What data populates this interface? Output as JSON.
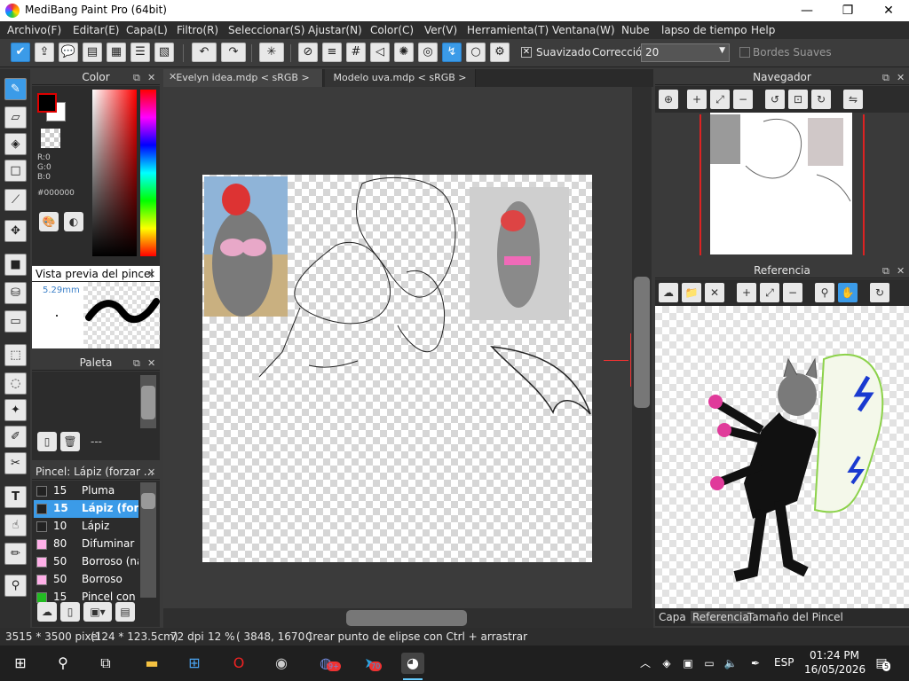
{
  "window": {
    "title": "MediBang Paint Pro (64bit)"
  },
  "menu": [
    "Archivo(F)",
    "Editar(E)",
    "Capa(L)",
    "Filtro(R)",
    "Seleccionar(S)",
    "Ajustar(N)",
    "Color(C)",
    "Ver(V)",
    "Herramienta(T)",
    "Ventana(W)",
    "Nube",
    "lapso de tiempo",
    "Help"
  ],
  "toolbar": {
    "smoothing_label": "Suavizado",
    "correction_label": "Corrección",
    "correction_value": "20",
    "soft_edges_label": "Bordes Suaves"
  },
  "color_panel": {
    "title": "Color",
    "r": "R:0",
    "g": "G:0",
    "b": "B:0",
    "hex": "#000000",
    "fg_color": "#000000",
    "bg_color": "#ffffff"
  },
  "brush_preview": {
    "title": "Vista previa del pincel",
    "size": "5.29mm"
  },
  "palette": {
    "title": "Paleta",
    "dash": "---"
  },
  "brush_panel": {
    "title": "Pincel: Lápiz (forzar ...",
    "items": [
      {
        "size": "15",
        "name": "Pluma",
        "color": "#222222"
      },
      {
        "size": "15",
        "name": "Lápiz (forza",
        "color": "#222222",
        "selected": true
      },
      {
        "size": "10",
        "name": "Lápiz",
        "color": "#222222"
      },
      {
        "size": "80",
        "name": "Difuminar",
        "color": "#ffb0e8"
      },
      {
        "size": "50",
        "name": "Borroso (nat",
        "color": "#ffb0e8"
      },
      {
        "size": "50",
        "name": "Borroso",
        "color": "#ffb0e8"
      },
      {
        "size": "15",
        "name": "Pincel con c",
        "color": "#22bb22"
      }
    ]
  },
  "tabs": [
    "Evelyn idea.mdp < sRGB >",
    "Modelo uva.mdp < sRGB >"
  ],
  "navigator": {
    "title": "Navegador"
  },
  "reference": {
    "title": "Referencia"
  },
  "bottom_tabs": [
    "Capa",
    "Referencia",
    "Tamaño del Pincel"
  ],
  "status": {
    "size": "3515 * 3500 pixel",
    "cm": "(124 * 123.5cm)",
    "dpi": "72 dpi",
    "zoom": "12 %",
    "coords": "( 3848, 1670 )",
    "hint": "Crear punto de elipse con Ctrl + arrastrar"
  },
  "taskbar": {
    "lang": "ESP",
    "time": "01:24 PM",
    "date": "16/05/2026",
    "discord_badge": "9+",
    "telegram_badge": "70",
    "notif_count": "5"
  }
}
